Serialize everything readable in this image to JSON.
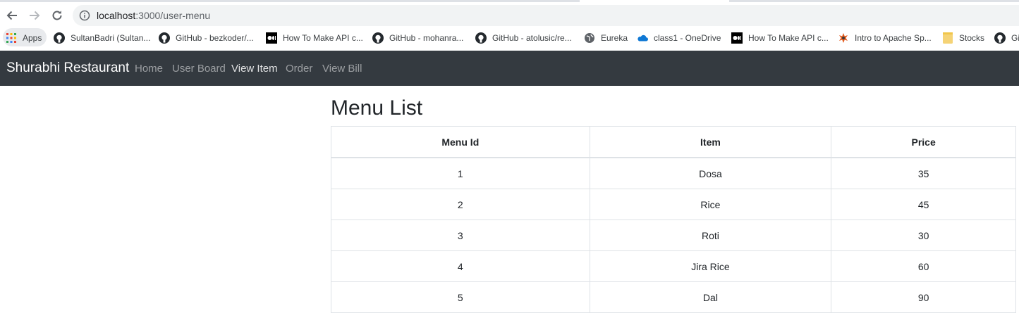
{
  "browser": {
    "url_host": "localhost",
    "url_path": ":3000/user-menu",
    "bookmarks": [
      {
        "label": "Apps",
        "icon": "apps-grid-icon"
      },
      {
        "label": "SultanBadri (Sultan...",
        "icon": "github-icon"
      },
      {
        "label": "GitHub - bezkoder/...",
        "icon": "github-icon"
      },
      {
        "label": "How To Make API c...",
        "icon": "medium-icon"
      },
      {
        "label": "GitHub - mohanra...",
        "icon": "github-icon"
      },
      {
        "label": "GitHub - atolusic/re...",
        "icon": "github-icon"
      },
      {
        "label": "Eureka",
        "icon": "globe-icon"
      },
      {
        "label": "class1 - OneDrive",
        "icon": "onedrive-icon"
      },
      {
        "label": "How To Make API c...",
        "icon": "medium-icon"
      },
      {
        "label": "Intro to Apache Sp...",
        "icon": "spark-icon"
      },
      {
        "label": "Stocks",
        "icon": "folder-icon"
      },
      {
        "label": "Gi",
        "icon": "github-icon"
      }
    ]
  },
  "navbar": {
    "brand": "Shurabhi Restaurant",
    "links": [
      {
        "label": "Home",
        "active": false
      },
      {
        "label": "User Board",
        "active": false
      },
      {
        "label": "View Item",
        "active": true
      },
      {
        "label": "Order",
        "active": false
      },
      {
        "label": "View Bill",
        "active": false
      }
    ]
  },
  "main": {
    "title": "Menu List",
    "columns": [
      "Menu Id",
      "Item",
      "Price"
    ],
    "rows": [
      [
        "1",
        "Dosa",
        "35"
      ],
      [
        "2",
        "Rice",
        "45"
      ],
      [
        "3",
        "Roti",
        "30"
      ],
      [
        "4",
        "Jira Rice",
        "60"
      ],
      [
        "5",
        "Dal",
        "90"
      ]
    ]
  },
  "colors": {
    "navbar_bg": "#343a40",
    "table_border": "#dee2e6",
    "omnibox_bg": "#f1f3f4"
  }
}
